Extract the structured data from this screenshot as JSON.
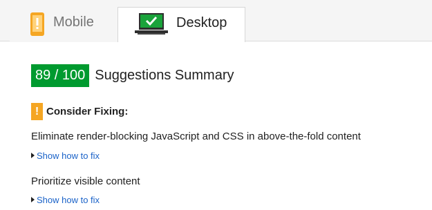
{
  "tabs": [
    {
      "label": "Mobile",
      "icon": "phone-warning-icon",
      "active": false
    },
    {
      "label": "Desktop",
      "icon": "laptop-check-icon",
      "active": true
    }
  ],
  "summary": {
    "score": "89 / 100",
    "title": "Suggestions Summary",
    "score_color": "#009a2f"
  },
  "consider_fixing": {
    "label": "Consider Fixing:",
    "icon": "warning-icon",
    "icon_color": "#f5a623"
  },
  "rules": [
    {
      "title": "Eliminate render-blocking JavaScript and CSS in above-the-fold content",
      "link": "Show how to fix"
    },
    {
      "title": "Prioritize visible content",
      "link": "Show how to fix"
    }
  ]
}
